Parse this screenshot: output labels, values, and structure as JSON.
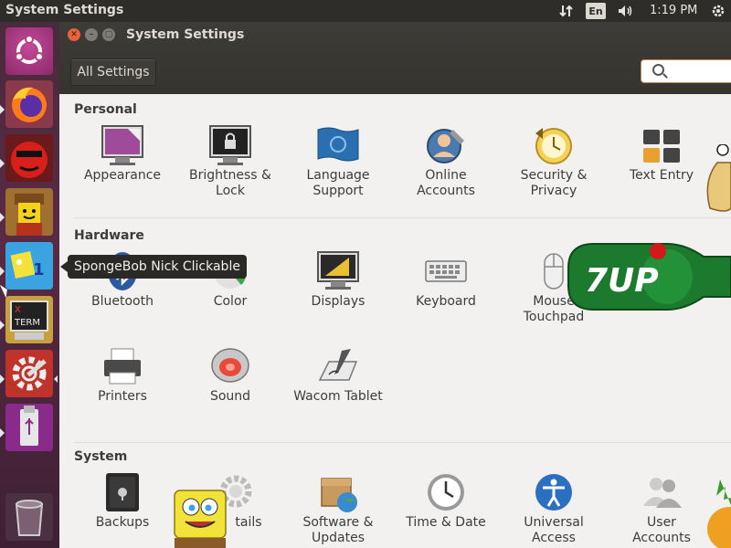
{
  "top_panel": {
    "title": "System Settings",
    "language": "En",
    "clock": "1:19 PM",
    "icons": [
      "network-arrows-icon",
      "volume-icon",
      "power-gear-icon"
    ]
  },
  "launcher": {
    "items": [
      "ubuntu-dash-icon",
      "firefox-icon",
      "red-face-app-icon",
      "lego-figure-app-icon",
      "spongebob-nick-clickable-icon",
      "xterm-icon",
      "system-settings-icon",
      "usb-drive-icon",
      "trash-icon"
    ],
    "tooltip": "SpongeBob Nick Clickable"
  },
  "window": {
    "title": "System Settings",
    "controls": [
      "close-icon",
      "minimize-icon",
      "maximize-icon"
    ],
    "all_settings": "All Settings",
    "search_placeholder": ""
  },
  "sections": {
    "personal": {
      "title": "Personal",
      "items": [
        {
          "label1": "Appearance",
          "label2": ""
        },
        {
          "label1": "Brightness &",
          "label2": "Lock"
        },
        {
          "label1": "Language",
          "label2": "Support"
        },
        {
          "label1": "Online",
          "label2": "Accounts"
        },
        {
          "label1": "Security &",
          "label2": "Privacy"
        },
        {
          "label1": "Text Entry",
          "label2": ""
        }
      ]
    },
    "hardware": {
      "title": "Hardware",
      "items": [
        {
          "label1": "Bluetooth",
          "label2": ""
        },
        {
          "label1": "Color",
          "label2": ""
        },
        {
          "label1": "Displays",
          "label2": ""
        },
        {
          "label1": "Keyboard",
          "label2": ""
        },
        {
          "label1": "Mouse",
          "label2": "Touchpad"
        },
        {
          "label1": "Printers",
          "label2": ""
        },
        {
          "label1": "Sound",
          "label2": ""
        },
        {
          "label1": "Wacom Tablet",
          "label2": ""
        }
      ]
    },
    "system": {
      "title": "System",
      "items": [
        {
          "label1": "Backups",
          "label2": ""
        },
        {
          "label1": "tails",
          "label2": ""
        },
        {
          "label1": "Software &",
          "label2": "Updates"
        },
        {
          "label1": "Time & Date",
          "label2": ""
        },
        {
          "label1": "Universal",
          "label2": "Access"
        },
        {
          "label1": "User",
          "label2": "Accounts"
        }
      ]
    }
  },
  "overlays": {
    "soda_bottle_text": "7UP",
    "colors": {
      "bottle_green": "#1b7a2e",
      "sponge_yellow": "#f2e23a",
      "ubuntu_orange": "#e95420"
    }
  }
}
